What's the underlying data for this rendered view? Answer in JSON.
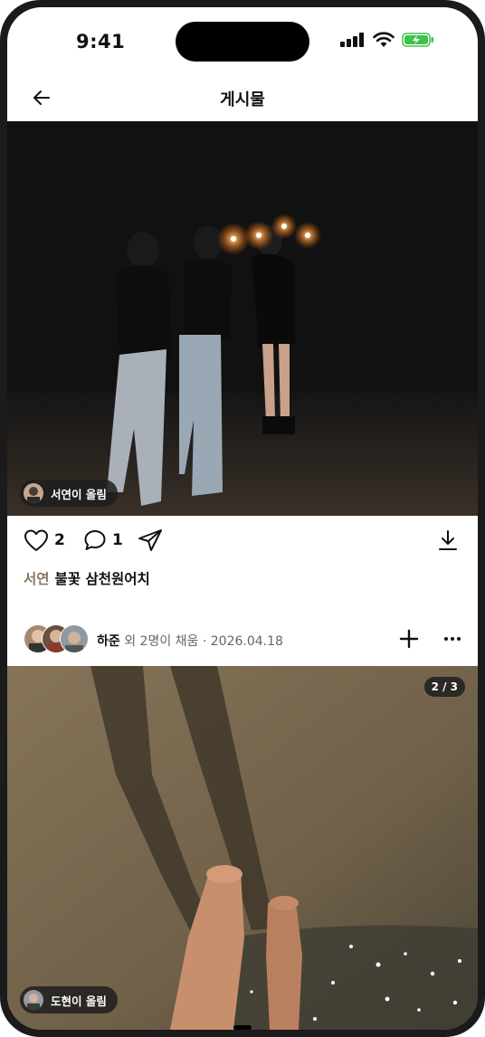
{
  "status_bar": {
    "time": "9:41"
  },
  "header": {
    "title": "게시물"
  },
  "post1": {
    "uploader_label": "서연이 올림",
    "likes": "2",
    "comments": "1",
    "caption_author": "서연",
    "caption_text": "불꽃 삼천원어치"
  },
  "post2": {
    "contributor_name": "하준",
    "contributor_suffix": " 외 2명이 채움 · 2026.04.18",
    "counter": "2 / 3",
    "uploader_label": "도현이 올림"
  },
  "icons": {
    "back": "arrow-left-icon",
    "like": "heart-icon",
    "comment": "speech-bubble-icon",
    "share": "paper-plane-icon",
    "download": "download-icon",
    "add": "plus-icon",
    "more": "ellipsis-icon"
  },
  "colors": {
    "author_accent": "#8a7662",
    "battery_green": "#3ec24a"
  }
}
